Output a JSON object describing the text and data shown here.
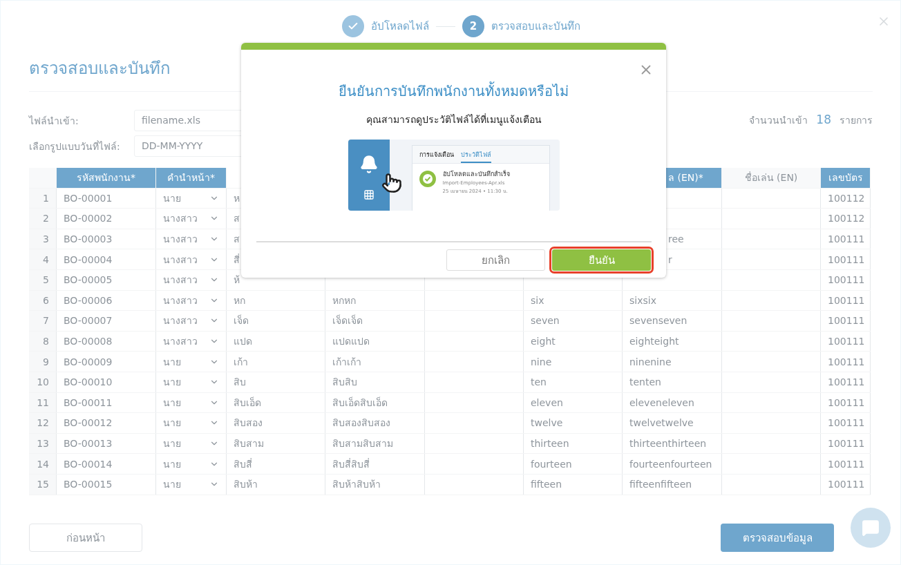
{
  "stepper": [
    {
      "label": "อัปโหลดไฟล์",
      "done": true
    },
    {
      "label": "ตรวจสอบและบันทึก",
      "marker": "2",
      "done": false
    }
  ],
  "page_title": "ตรวจสอบและบันทึก",
  "fields": [
    {
      "label": "ไฟล์นำเข้า:",
      "value": "filename.xls"
    },
    {
      "label": "เลือกรูปแบบวันที่ไฟล์:",
      "value": "DD-MM-YYYY"
    }
  ],
  "import_count": {
    "label": "จำนวนนำเข้า",
    "count": "18",
    "unit": "รายการ"
  },
  "table": {
    "columns": [
      {
        "kind": "blank_visible",
        "highlighted": false
      },
      {
        "kind": "text",
        "label": "รหัสพนักงาน*",
        "highlighted": true
      },
      {
        "kind": "text",
        "label": "คำนำหน้า*",
        "highlighted": true
      },
      {
        "kind": "blank"
      },
      {
        "kind": "blank"
      },
      {
        "kind": "blank"
      },
      {
        "kind": "blank"
      },
      {
        "kind": "clipped",
        "label": "ล (EN)*",
        "highlighted": true
      },
      {
        "kind": "text",
        "label": "ชื่อเล่น (EN)",
        "highlighted": false
      },
      {
        "kind": "text",
        "label": "เลขบัตร",
        "highlighted": true
      }
    ],
    "rows": [
      {
        "cells": [
          {
            "kind": "number",
            "text": "1"
          },
          {
            "kind": "text",
            "text": "BO-00001"
          },
          {
            "kind": "select",
            "text": "นาย"
          },
          {
            "kind": "text",
            "text": "ห"
          },
          {
            "kind": "blank"
          },
          {
            "kind": "blank"
          },
          {
            "kind": "blank"
          },
          {
            "kind": "blank"
          },
          {
            "kind": "blank"
          },
          {
            "kind": "text",
            "text": "100112"
          }
        ]
      },
      {
        "cells": [
          {
            "kind": "number",
            "text": "2"
          },
          {
            "kind": "text",
            "text": "BO-00002"
          },
          {
            "kind": "select",
            "text": "นางสาว"
          },
          {
            "kind": "text",
            "text": "ส"
          },
          {
            "kind": "blank"
          },
          {
            "kind": "blank"
          },
          {
            "kind": "blank"
          },
          {
            "kind": "blank"
          },
          {
            "kind": "blank"
          },
          {
            "kind": "text",
            "text": "100112"
          }
        ]
      },
      {
        "cells": [
          {
            "kind": "number",
            "text": "3"
          },
          {
            "kind": "text",
            "text": "BO-00003"
          },
          {
            "kind": "select",
            "text": "นางสาว"
          },
          {
            "kind": "text",
            "text": "ส"
          },
          {
            "kind": "blank"
          },
          {
            "kind": "blank"
          },
          {
            "kind": "blank"
          },
          {
            "kind": "clipped",
            "text": "ree"
          },
          {
            "kind": "blank"
          },
          {
            "kind": "text",
            "text": "100111"
          }
        ]
      },
      {
        "cells": [
          {
            "kind": "number",
            "text": "4"
          },
          {
            "kind": "text",
            "text": "BO-00004"
          },
          {
            "kind": "select",
            "text": "นางสาว"
          },
          {
            "kind": "text",
            "text": "สี่"
          },
          {
            "kind": "blank"
          },
          {
            "kind": "blank"
          },
          {
            "kind": "blank"
          },
          {
            "kind": "clipped",
            "text": "r"
          },
          {
            "kind": "blank"
          },
          {
            "kind": "text",
            "text": "100111"
          }
        ]
      },
      {
        "cells": [
          {
            "kind": "number",
            "text": "5"
          },
          {
            "kind": "text",
            "text": "BO-00005"
          },
          {
            "kind": "select",
            "text": "นางสาว"
          },
          {
            "kind": "text",
            "text": "ห้"
          },
          {
            "kind": "blank"
          },
          {
            "kind": "blank"
          },
          {
            "kind": "blank"
          },
          {
            "kind": "blank"
          },
          {
            "kind": "blank"
          },
          {
            "kind": "text",
            "text": "100111"
          }
        ]
      },
      {
        "cells": [
          {
            "kind": "number",
            "text": "6"
          },
          {
            "kind": "text",
            "text": "BO-00006"
          },
          {
            "kind": "select",
            "text": "นางสาว"
          },
          {
            "kind": "text",
            "text": "หก"
          },
          {
            "kind": "text",
            "text": "หกหก"
          },
          {
            "kind": "blank"
          },
          {
            "kind": "text",
            "text": "six"
          },
          {
            "kind": "text",
            "text": "sixsix"
          },
          {
            "kind": "blank"
          },
          {
            "kind": "text",
            "text": "100111"
          }
        ]
      },
      {
        "cells": [
          {
            "kind": "number",
            "text": "7"
          },
          {
            "kind": "text",
            "text": "BO-00007"
          },
          {
            "kind": "select",
            "text": "นางสาว"
          },
          {
            "kind": "text",
            "text": "เจ็ด"
          },
          {
            "kind": "text",
            "text": "เจ็ดเจ็ด"
          },
          {
            "kind": "blank"
          },
          {
            "kind": "text",
            "text": "seven"
          },
          {
            "kind": "text",
            "text": "sevenseven"
          },
          {
            "kind": "blank"
          },
          {
            "kind": "text",
            "text": "100111"
          }
        ]
      },
      {
        "cells": [
          {
            "kind": "number",
            "text": "8"
          },
          {
            "kind": "text",
            "text": "BO-00008"
          },
          {
            "kind": "select",
            "text": "นางสาว"
          },
          {
            "kind": "text",
            "text": "แปด"
          },
          {
            "kind": "text",
            "text": "แปดแปด"
          },
          {
            "kind": "blank"
          },
          {
            "kind": "text",
            "text": "eight"
          },
          {
            "kind": "text",
            "text": "eighteight"
          },
          {
            "kind": "blank"
          },
          {
            "kind": "text",
            "text": "100111"
          }
        ]
      },
      {
        "cells": [
          {
            "kind": "number",
            "text": "9"
          },
          {
            "kind": "text",
            "text": "BO-00009"
          },
          {
            "kind": "select",
            "text": "นาย"
          },
          {
            "kind": "text",
            "text": "เก้า"
          },
          {
            "kind": "text",
            "text": "เก้าเก้า"
          },
          {
            "kind": "blank"
          },
          {
            "kind": "text",
            "text": "nine"
          },
          {
            "kind": "text",
            "text": "ninenine"
          },
          {
            "kind": "blank"
          },
          {
            "kind": "text",
            "text": "100111"
          }
        ]
      },
      {
        "cells": [
          {
            "kind": "number",
            "text": "10"
          },
          {
            "kind": "text",
            "text": "BO-00010"
          },
          {
            "kind": "select",
            "text": "นาย"
          },
          {
            "kind": "text",
            "text": "สิบ"
          },
          {
            "kind": "text",
            "text": "สิบสิบ"
          },
          {
            "kind": "blank"
          },
          {
            "kind": "text",
            "text": "ten"
          },
          {
            "kind": "text",
            "text": "tenten"
          },
          {
            "kind": "blank"
          },
          {
            "kind": "text",
            "text": "100111"
          }
        ]
      },
      {
        "cells": [
          {
            "kind": "number",
            "text": "11"
          },
          {
            "kind": "text",
            "text": "BO-00011"
          },
          {
            "kind": "select",
            "text": "นาย"
          },
          {
            "kind": "text",
            "text": "สิบเอ็ด"
          },
          {
            "kind": "text",
            "text": "สิบเอ็ดสิบเอ็ด"
          },
          {
            "kind": "blank"
          },
          {
            "kind": "text",
            "text": "eleven"
          },
          {
            "kind": "text",
            "text": "eleveneleven"
          },
          {
            "kind": "blank"
          },
          {
            "kind": "text",
            "text": "100111"
          }
        ]
      },
      {
        "cells": [
          {
            "kind": "number",
            "text": "12"
          },
          {
            "kind": "text",
            "text": "BO-00012"
          },
          {
            "kind": "select",
            "text": "นาย"
          },
          {
            "kind": "text",
            "text": "สิบสอง"
          },
          {
            "kind": "text",
            "text": "สิบสองสิบสอง"
          },
          {
            "kind": "blank"
          },
          {
            "kind": "text",
            "text": "twelve"
          },
          {
            "kind": "text",
            "text": "twelvetwelve"
          },
          {
            "kind": "blank"
          },
          {
            "kind": "text",
            "text": "100111"
          }
        ]
      },
      {
        "cells": [
          {
            "kind": "number",
            "text": "13"
          },
          {
            "kind": "text",
            "text": "BO-00013"
          },
          {
            "kind": "select",
            "text": "นาย"
          },
          {
            "kind": "text",
            "text": "สิบสาม"
          },
          {
            "kind": "text",
            "text": "สิบสามสิบสาม"
          },
          {
            "kind": "blank"
          },
          {
            "kind": "text",
            "text": "thirteen"
          },
          {
            "kind": "text",
            "text": "thirteenthirteen"
          },
          {
            "kind": "blank"
          },
          {
            "kind": "text",
            "text": "100111"
          }
        ]
      },
      {
        "cells": [
          {
            "kind": "number",
            "text": "14"
          },
          {
            "kind": "text",
            "text": "BO-00014"
          },
          {
            "kind": "select",
            "text": "นาย"
          },
          {
            "kind": "text",
            "text": "สิบสี่"
          },
          {
            "kind": "text",
            "text": "สิบสี่สิบสี่"
          },
          {
            "kind": "blank"
          },
          {
            "kind": "text",
            "text": "fourteen"
          },
          {
            "kind": "text",
            "text": "fourteenfourteen"
          },
          {
            "kind": "blank"
          },
          {
            "kind": "text",
            "text": "100111"
          }
        ]
      },
      {
        "cells": [
          {
            "kind": "number",
            "text": "15"
          },
          {
            "kind": "text",
            "text": "BO-00015"
          },
          {
            "kind": "select",
            "text": "นาย"
          },
          {
            "kind": "text",
            "text": "สิบห้า"
          },
          {
            "kind": "text",
            "text": "สิบห้าสิบห้า"
          },
          {
            "kind": "blank"
          },
          {
            "kind": "text",
            "text": "fifteen"
          },
          {
            "kind": "text",
            "text": "fifteenfifteen"
          },
          {
            "kind": "blank"
          },
          {
            "kind": "text",
            "text": "100111"
          }
        ]
      }
    ]
  },
  "footer": {
    "back": "ก่อนหน้า",
    "validate": "ตรวจสอบข้อมูล"
  },
  "dialog": {
    "title": "ยืนยันการบันทึกพนักงานทั้งหมดหรือไม่",
    "subtitle": "คุณสามารถดูประวัติไฟล์ได้ที่เมนูแจ้งเตือน",
    "illustration": {
      "tabs": [
        {
          "label": "การแจ้งเตือน",
          "selected": false
        },
        {
          "label": "ประวัติไฟล์",
          "selected": true
        }
      ],
      "item_title": "อัปโหลดและบันทึกสำเร็จ",
      "item_file": "Import-Employees-Apr.xls",
      "item_time": "25 เมษายน 2024 • 11:30 น."
    },
    "buttons": [
      {
        "kind": "secondary",
        "label": "ยกเลิก",
        "highlighted": false
      },
      {
        "kind": "primary",
        "label": "ยืนยัน",
        "highlighted": true
      }
    ]
  }
}
